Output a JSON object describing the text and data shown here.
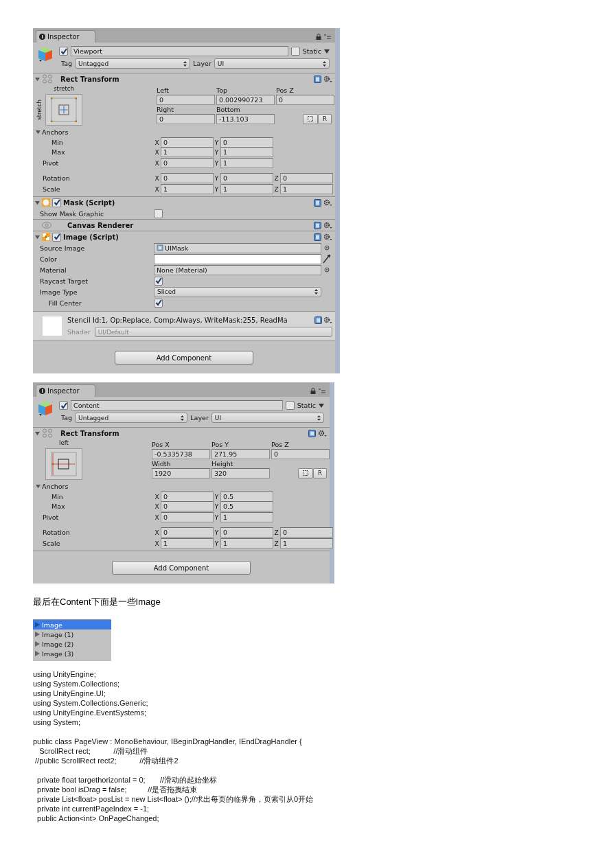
{
  "inspectors": [
    {
      "tab": "Inspector",
      "object": {
        "name": "Viewport",
        "active": true,
        "static_label": "Static",
        "static": false,
        "tag_label": "Tag",
        "tag": "Untagged",
        "layer_label": "Layer",
        "layer": "UI"
      },
      "rect_transform": {
        "title": "Rect Transform",
        "expanded": true,
        "preset": {
          "kind": "stretch",
          "top_label": "stretch",
          "side_label": "stretch"
        },
        "labels_1": [
          "Left",
          "Top",
          "Pos Z"
        ],
        "values_1": [
          "0",
          "0.002990723",
          "0"
        ],
        "labels_2": [
          "Right",
          "Bottom"
        ],
        "values_2": [
          "0",
          "-113.103"
        ],
        "raw_button": "R",
        "anchors": {
          "label": "Anchors",
          "expanded": true,
          "rows": [
            {
              "label": "Min",
              "fields": [
                {
                  "axis": "X",
                  "value": "0"
                },
                {
                  "axis": "Y",
                  "value": "0"
                }
              ]
            },
            {
              "label": "Max",
              "fields": [
                {
                  "axis": "X",
                  "value": "1"
                },
                {
                  "axis": "Y",
                  "value": "1"
                }
              ]
            }
          ]
        },
        "pivot": {
          "label": "Pivot",
          "fields": [
            {
              "axis": "X",
              "value": "0"
            },
            {
              "axis": "Y",
              "value": "1"
            }
          ]
        },
        "rotation": {
          "label": "Rotation",
          "fields": [
            {
              "axis": "X",
              "value": "0"
            },
            {
              "axis": "Y",
              "value": "0"
            },
            {
              "axis": "Z",
              "value": "0"
            }
          ]
        },
        "scale": {
          "label": "Scale",
          "fields": [
            {
              "axis": "X",
              "value": "1"
            },
            {
              "axis": "Y",
              "value": "1"
            },
            {
              "axis": "Z",
              "value": "1"
            }
          ]
        }
      },
      "components": [
        {
          "kind": "mask",
          "title": "Mask (Script)",
          "enabled": true,
          "expanded": true,
          "properties": [
            {
              "kind": "checkbox",
              "label": "Show Mask Graphic",
              "checked": false
            }
          ]
        },
        {
          "kind": "renderer",
          "title": "Canvas Renderer"
        },
        {
          "kind": "image",
          "title": "Image (Script)",
          "enabled": true,
          "expanded": true,
          "properties": [
            {
              "kind": "sprite",
              "label": "Source Image",
              "value": "UIMask"
            },
            {
              "kind": "color",
              "label": "Color",
              "color": "#ffffff"
            },
            {
              "kind": "object",
              "label": "Material",
              "value": "None (Material)"
            },
            {
              "kind": "checkbox",
              "label": "Raycast Target",
              "checked": true
            },
            {
              "kind": "dropdown",
              "label": "Image Type",
              "value": "Sliced",
              "children": [
                {
                  "kind": "checkbox",
                  "label": "Fill Center",
                  "checked": true
                }
              ]
            }
          ]
        }
      ],
      "material": {
        "info": "Stencil Id:1, Op:Replace, Comp:Always, WriteMask:255, ReadMa",
        "shader_label": "Shader",
        "shader": "UI/Default"
      },
      "add_button": "Add Component"
    },
    {
      "tab": "Inspector",
      "object": {
        "name": "Content",
        "active": true,
        "static_label": "Static",
        "static": false,
        "tag_label": "Tag",
        "tag": "Untagged",
        "layer_label": "Layer",
        "layer": "UI"
      },
      "rect_transform": {
        "title": "Rect Transform",
        "expanded": true,
        "preset": {
          "kind": "left-middle",
          "top_label": "left"
        },
        "labels_1": [
          "Pos X",
          "Pos Y",
          "Pos Z"
        ],
        "values_1": [
          "-0.5335738",
          "271.95",
          "0"
        ],
        "labels_2": [
          "Width",
          "Height"
        ],
        "values_2": [
          "1920",
          "320"
        ],
        "raw_button": "R",
        "anchors": {
          "label": "Anchors",
          "expanded": true,
          "rows": [
            {
              "label": "Min",
              "fields": [
                {
                  "axis": "X",
                  "value": "0"
                },
                {
                  "axis": "Y",
                  "value": "0.5"
                }
              ]
            },
            {
              "label": "Max",
              "fields": [
                {
                  "axis": "X",
                  "value": "0"
                },
                {
                  "axis": "Y",
                  "value": "0.5"
                }
              ]
            }
          ]
        },
        "pivot": {
          "label": "Pivot",
          "fields": [
            {
              "axis": "X",
              "value": "0"
            },
            {
              "axis": "Y",
              "value": "1"
            }
          ]
        },
        "rotation": {
          "label": "Rotation",
          "fields": [
            {
              "axis": "X",
              "value": "0"
            },
            {
              "axis": "Y",
              "value": "0"
            },
            {
              "axis": "Z",
              "value": "0"
            }
          ]
        },
        "scale": {
          "label": "Scale",
          "fields": [
            {
              "axis": "X",
              "value": "1"
            },
            {
              "axis": "Y",
              "value": "1"
            },
            {
              "axis": "Z",
              "value": "1"
            }
          ]
        }
      },
      "add_button": "Add Component"
    }
  ],
  "paragraph": "最后在Content下面是一些Image",
  "hierarchy": [
    {
      "label": "Image",
      "selected": true
    },
    {
      "label": "Image (1)",
      "selected": false
    },
    {
      "label": "Image (2)",
      "selected": false
    },
    {
      "label": "Image (3)",
      "selected": false
    }
  ],
  "code": [
    [
      "using UnityEngine;",
      "using System.Collections;",
      "using UnityEngine.UI;",
      "using System.Collections.Generic;",
      "using UnityEngine.EventSystems;",
      "using System;"
    ],
    [
      "public class PageView : MonoBehaviour, IBeginDragHandler, IEndDragHandler {",
      "   ScrollRect rect;           //滑动组件",
      " //public ScrollRect rect2;           //滑动组件2"
    ],
    [
      "  private float targethorizontal = 0;       //滑动的起始坐标",
      "  private bool isDrag = false;          //是否拖拽结束",
      "  private List<float> posList = new List<float> ();//求出每页的临界角，页索引从0开始",
      "  private int currentPageIndex = -1;",
      "  public Action<int> OnPageChanged;"
    ]
  ]
}
